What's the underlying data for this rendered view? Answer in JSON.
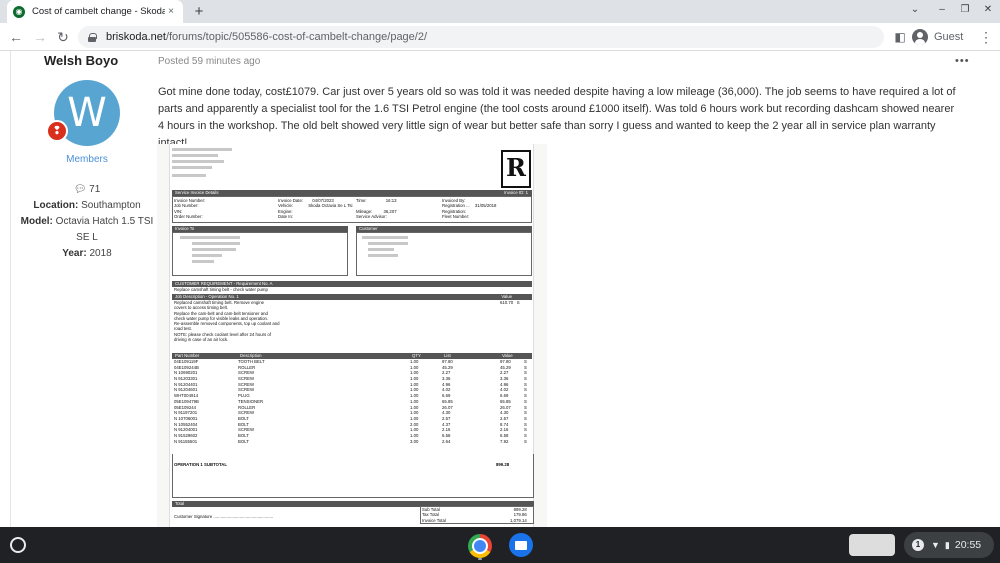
{
  "browser": {
    "tab_title": "Cost of cambelt change - Skoda",
    "tab_close": "×",
    "new_tab": "+",
    "url_domain": "briskoda.net",
    "url_path": "/forums/topic/505586-cost-of-cambelt-change/page/2/",
    "profile_label": "Guest"
  },
  "post": {
    "author": "Welsh Boyo",
    "avatar_letter": "W",
    "group": "Members",
    "post_count": "71",
    "location_label": "Location:",
    "location_value": "Southampton",
    "model_label": "Model:",
    "model_value": "Octavia Hatch 1.5 TSI SE L",
    "year_label": "Year:",
    "year_value": "2018",
    "posted": "Posted 59 minutes ago",
    "body": "Got mine done today, cost£1079. Car just over 5 years old so was told it was needed despite having a low mileage (36,000). The job seems to have required a lot of parts and apparently a specialist tool for the 1.6 TSI Petrol engine (the tool costs around £1000 itself). Was told 6 hours work but recording dashcam showed nearer 4 hours in the workshop. The old belt showed very little sign of wear but better safe than sorry I guess and wanted to keep the 2 year all in service plan warranty intact!"
  },
  "invoice": {
    "logo": "R",
    "service_invoice": "Service Invoice Details",
    "invoice_id": "Invoice ID: 1",
    "invoice_number": "Invoice Number:",
    "job_number": "Job Number:",
    "vin": "VIN:",
    "order_number": "Order Number:",
    "invoice_date_label": "Invoice Date:",
    "invoice_date": "04/07/2023",
    "vehicle_label": "Vehicle:",
    "vehicle": "Skoda Octavia Se L Tsi",
    "engine_label": "Engine:",
    "date_in_label": "Date In:",
    "time_label": "Time:",
    "time": "16:13",
    "mileage_label": "Mileage:",
    "mileage": "36,207",
    "service_advisor": "Service Advisor:",
    "invoiced_by": "Invoiced By:",
    "registration_date_label": "Registration ...",
    "registration_date": "31/05/2018",
    "registration": "Registration:",
    "fleet_number": "Fleet Number:",
    "invoice_to": "Invoice To",
    "customer": "Customer",
    "customer_req": "CUSTOMER REQUIREMENT - Requirement No. A",
    "req_text": "Replace camshaft timing belt - check water pump",
    "job_desc": "Job Description - Operation No. 1",
    "value_label": "Value",
    "job_value": "610.70",
    "job_lines": [
      "Replaced camshaft timing belt. Remove engine",
      "covers to access timing belt.",
      "Replace the cam-belt and cam-belt tensioner and",
      "check water pump for visible leaks and operation.",
      "Re-assemble removed components, top up coolant and",
      "road test.",
      "NOTE: please check coolant level after 24 hours of",
      "driving in case of an air lock."
    ],
    "parts_headers": [
      "Part Number",
      "Description",
      "QTY",
      "List",
      "Value"
    ],
    "parts": [
      [
        "04E109119F",
        "TOOTH BELT",
        "1.00",
        "97.80",
        "97.80",
        "S"
      ],
      [
        "04E109244B",
        "ROLLER",
        "1.00",
        "45.29",
        "45.29",
        "S"
      ],
      [
        "N 10690201",
        "SCREW",
        "1.00",
        "2.27",
        "2.27",
        "S"
      ],
      [
        "N 91203301",
        "SCREW",
        "1.00",
        "3.36",
        "3.36",
        "S"
      ],
      [
        "N 91204401",
        "SCREW",
        "1.00",
        "4.96",
        "4.96",
        "S"
      ],
      [
        "N 91204601",
        "SCREW",
        "1.00",
        "4.02",
        "4.02",
        "S"
      ],
      [
        "WHT004914",
        "PLUG",
        "1.00",
        "6.69",
        "6.69",
        "S"
      ],
      [
        "05E109479B",
        "TENSIONER",
        "1.00",
        "65.85",
        "65.85",
        "S"
      ],
      [
        "05E109244",
        "ROLLER",
        "1.00",
        "26.07",
        "26.07",
        "S"
      ],
      [
        "N 91197201",
        "SCREW",
        "1.00",
        "4.30",
        "4.30",
        "S"
      ],
      [
        "N 10706001",
        "BOLT",
        "1.00",
        "2.57",
        "2.57",
        "S"
      ],
      [
        "N 10552404",
        "BOLT",
        "2.00",
        "4.37",
        "8.74",
        "S"
      ],
      [
        "N 91204001",
        "SCREW",
        "1.00",
        "2.16",
        "2.16",
        "S"
      ],
      [
        "N 91529602",
        "BOLT",
        "1.00",
        "6.58",
        "6.58",
        "S"
      ],
      [
        "N 91155501",
        "BOLT",
        "3.00",
        "2.64",
        "7.92",
        "S"
      ]
    ],
    "subtotal_label": "OPERATION 1 SUBTOTAL",
    "subtotal_value": "899.28",
    "total_label": "Total",
    "customer_signature": "Customer Signature ..................................................",
    "sub_total_label": "Sub Total",
    "sub_total": "899.28",
    "tax_total_label": "Tax Total",
    "tax_total": "179.86",
    "invoice_total_label": "Invoice Total",
    "invoice_total": "1,079.14"
  },
  "shelf": {
    "notification_count": "1",
    "time": "20:55"
  }
}
